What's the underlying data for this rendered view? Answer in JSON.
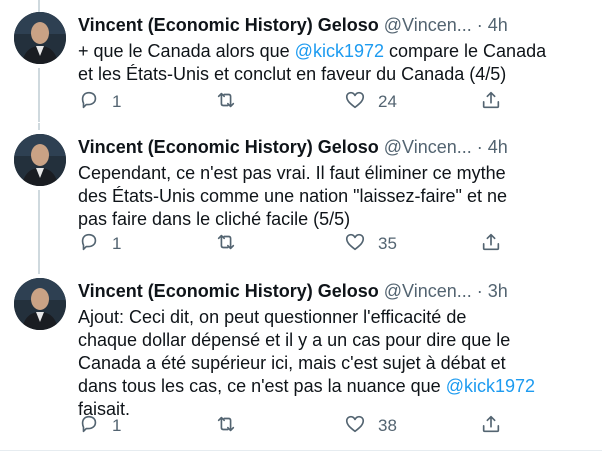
{
  "colors": {
    "mention": "#1d9bf0",
    "secondary_text": "#536471",
    "primary_text": "#0f1419",
    "thread_line": "#cfd9de"
  },
  "icons": {
    "reply": "reply-icon",
    "retweet": "retweet-icon",
    "like": "heart-icon",
    "share": "share-icon"
  },
  "tweets": [
    {
      "author_name": "Vincent (Economic History) Geloso",
      "handle": "@Vincen...",
      "separator": "·",
      "time": "4h",
      "text_parts": [
        "+ que le Canada alors que ",
        "@kick1972",
        " compare le Canada\net les États-Unis et conclut en faveur du Canada (4/5)"
      ],
      "replies": "1",
      "retweets": "",
      "likes": "24"
    },
    {
      "author_name": "Vincent (Economic History) Geloso",
      "handle": "@Vincen...",
      "separator": "·",
      "time": "4h",
      "text_parts": [
        "Cependant, ce n'est pas vrai. Il faut éliminer ce mythe\ndes États-Unis comme une nation \"laissez-faire\" et ne\npas faire dans le cliché facile (5/5)"
      ],
      "replies": "1",
      "retweets": "",
      "likes": "35"
    },
    {
      "author_name": "Vincent (Economic History) Geloso",
      "handle": "@Vincen...",
      "separator": "·",
      "time": "3h",
      "text_parts": [
        "Ajout: Ceci dit, on peut questionner l'efficacité de\nchaque dollar dépensé et il y a un cas pour dire que le\nCanada a été supérieur ici, mais c'est sujet à débat et\ndans tous les cas, ce n'est pas la nuance que ",
        "@kick1972",
        "\nfaisait."
      ],
      "replies": "1",
      "retweets": "",
      "likes": "38"
    }
  ]
}
